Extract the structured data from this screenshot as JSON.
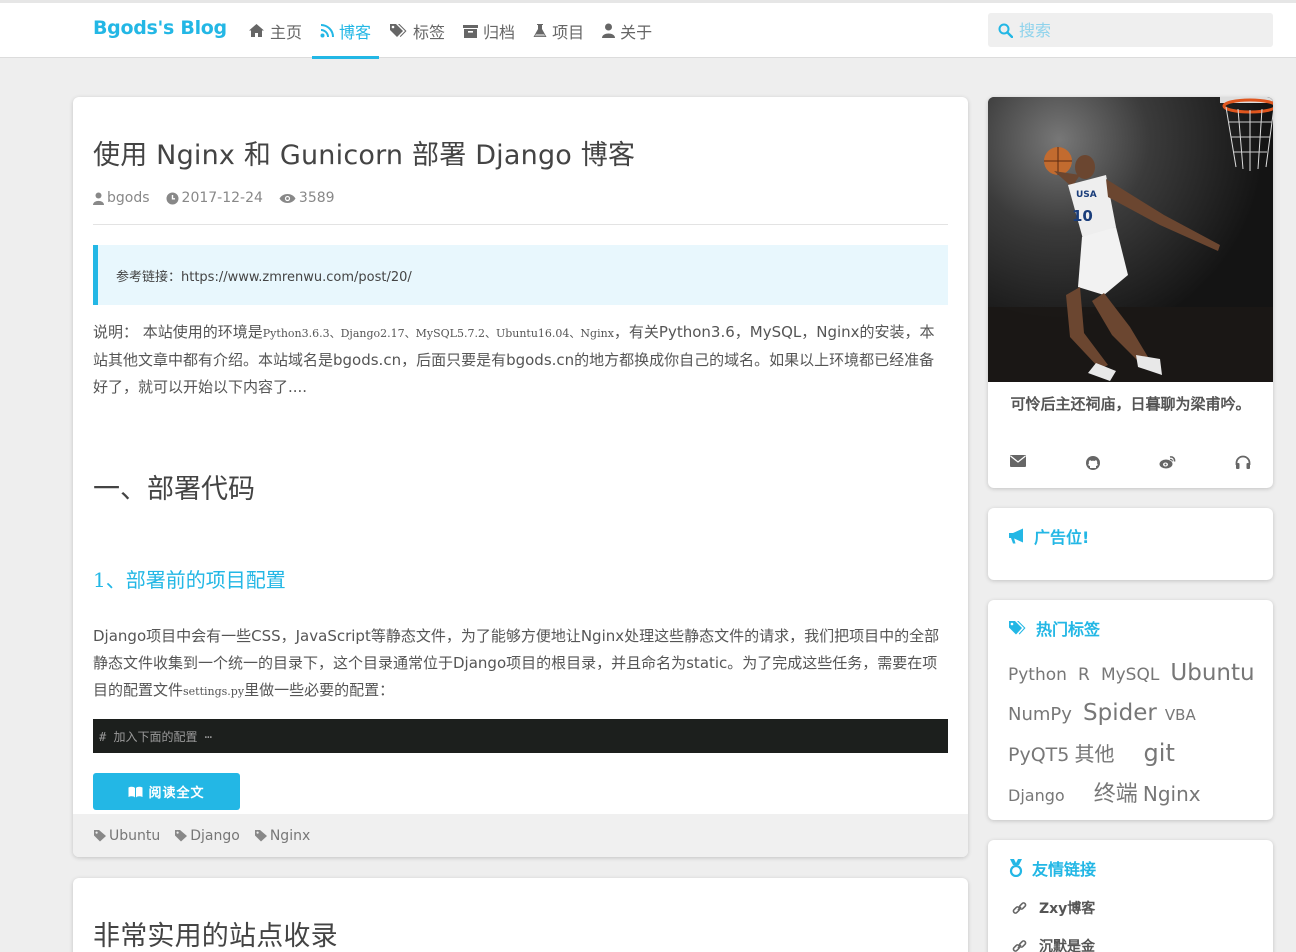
{
  "navbar": {
    "brand": "Bgods's Blog",
    "items": [
      {
        "label": "主页",
        "icon": "home-icon",
        "active": false
      },
      {
        "label": "博客",
        "icon": "rss-icon",
        "active": true
      },
      {
        "label": "标签",
        "icon": "tags-icon",
        "active": false
      },
      {
        "label": "归档",
        "icon": "archive-icon",
        "active": false
      },
      {
        "label": "项目",
        "icon": "flask-icon",
        "active": false
      },
      {
        "label": "关于",
        "icon": "user-icon",
        "active": false
      }
    ],
    "search_placeholder": "搜索"
  },
  "post": {
    "title": "使用 Nginx 和 Gunicorn 部署 Django 博客",
    "author": "bgods",
    "date": "2017-12-24",
    "views": "3589",
    "quote": "参考链接：https://www.zmrenwu.com/post/20/",
    "intro_prefix": "说明： 本站使用的环境是",
    "intro_env": "Python3.6.3、Django2.17、MySQL5.7.2、Ubuntu16.04、Nginx",
    "intro_rest": "，有关Python3.6，MySQL，Nginx的安装，本站其他文章中都有介绍。本站域名是bgods.cn，后面只要是有bgods.cn的地方都换成你自己的域名。如果以上环境都已经准备好了，就可以开始以下内容了....",
    "heading1": "一、部署代码",
    "heading2": "1、部署前的项目配置",
    "para2_prefix": "Django项目中会有一些CSS，JavaScript等静态文件，为了能够方便地让Nginx处理这些静态文件的请求，我们把项目中的全部静态文件收集到一个统一的目录下，这个目录通常位于Django项目的根目录，并且命名为static。为了完成这些任务，需要在项目的配置文件",
    "para2_file": "settings.py",
    "para2_suffix": "里做一些必要的配置：",
    "code": "# 加入下面的配置 ⋯",
    "read_more": "阅读全文",
    "tags": [
      "Ubuntu",
      "Django",
      "Nginx"
    ]
  },
  "post2": {
    "title": "非常实用的站点收录"
  },
  "profile": {
    "motto": "可怜后主还祠庙，日暮聊为梁甫吟。",
    "socials": [
      "envelope-icon",
      "github-icon",
      "weibo-icon",
      "headphones-icon"
    ]
  },
  "ad": {
    "title": "广告位!"
  },
  "hot_tags": {
    "title": "热门标签",
    "tags": [
      {
        "label": "Python",
        "size": 17
      },
      {
        "label": "R",
        "size": 17
      },
      {
        "label": "MySQL",
        "size": 17
      },
      {
        "label": "Ubuntu",
        "size": 24
      },
      {
        "label": "NumPy",
        "size": 18
      },
      {
        "label": "Spider",
        "size": 24
      },
      {
        "label": "VBA",
        "size": 15
      },
      {
        "label": "PyQT5",
        "size": 19
      },
      {
        "label": "其他",
        "size": 20
      },
      {
        "label": "git",
        "size": 24
      },
      {
        "label": "Django",
        "size": 16
      },
      {
        "label": "终端",
        "size": 22
      },
      {
        "label": "Nginx",
        "size": 20
      }
    ]
  },
  "links": {
    "title": "友情链接",
    "items": [
      "Zxy博客",
      "沉默是金"
    ]
  },
  "colors": {
    "accent": "#23b7e5",
    "code_bg": "#1c1f1d"
  }
}
